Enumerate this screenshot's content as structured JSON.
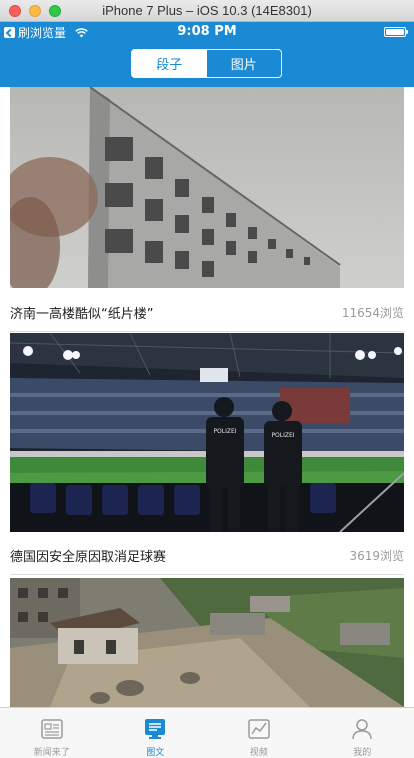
{
  "window": {
    "title": "iPhone 7 Plus – iOS 10.3 (14E8301)"
  },
  "status_bar": {
    "back_app_label": "刷浏览量",
    "time": "9:08 PM",
    "icons": [
      "back-chevron-icon",
      "wifi-icon",
      "battery-icon"
    ]
  },
  "segmented_control": {
    "items": [
      {
        "label": "段子",
        "selected": false
      },
      {
        "label": "图片",
        "selected": true
      }
    ]
  },
  "feed": {
    "items": [
      {
        "title": "济南一高楼酷似“纸片楼”",
        "views": "11654浏览",
        "image": "thin-building-photo"
      },
      {
        "title": "德国因安全原因取消足球赛",
        "views": "3619浏览",
        "image": "stadium-police-photo"
      },
      {
        "title": "",
        "views": "",
        "image": "landslide-village-photo"
      }
    ]
  },
  "tabbar": {
    "items": [
      {
        "label": "新闻来了",
        "icon": "news-icon",
        "selected": false
      },
      {
        "label": "图文",
        "icon": "photo-text-icon",
        "selected": true
      },
      {
        "label": "视频",
        "icon": "chart-icon",
        "selected": false
      },
      {
        "label": "我的",
        "icon": "profile-icon",
        "selected": false
      }
    ]
  },
  "colors": {
    "accent": "#1a8ad4",
    "tab_inactive": "#9a9a9a",
    "caption_text": "#222222",
    "views_text": "#9a9a9a"
  }
}
